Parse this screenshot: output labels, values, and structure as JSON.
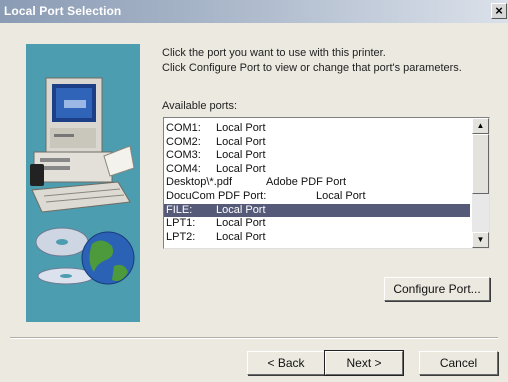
{
  "window": {
    "title": "Local Port Selection",
    "close_label": "×"
  },
  "instructions": {
    "line1": "Click the port you want to use with this printer.",
    "line2": "Click Configure Port to view or change that port's parameters."
  },
  "ports_label": "Available ports:",
  "ports": [
    {
      "port": "COM1:",
      "desc": "Local Port"
    },
    {
      "port": "COM2:",
      "desc": "Local Port"
    },
    {
      "port": "COM3:",
      "desc": "Local Port"
    },
    {
      "port": "COM4:",
      "desc": "Local Port"
    },
    {
      "port": "Desktop\\*.pdf",
      "desc": "Adobe PDF Port"
    },
    {
      "port": "DocuCom PDF Port:",
      "desc": "Local Port"
    },
    {
      "port": "FILE:",
      "desc": "Local Port"
    },
    {
      "port": "LPT1:",
      "desc": "Local Port"
    },
    {
      "port": "LPT2:",
      "desc": "Local Port"
    }
  ],
  "selected_port": "FILE:",
  "buttons": {
    "configure": "Configure Port...",
    "back": "< Back",
    "next": "Next >",
    "cancel": "Cancel"
  },
  "icons": {
    "art": [
      "computer-icon",
      "cd-disc-icon",
      "globe-icon"
    ],
    "scroll_up": "scroll-up-arrow-icon",
    "scroll_down": "scroll-down-arrow-icon"
  },
  "colors": {
    "art_panel": "#4d9db0",
    "selection": "#555a79",
    "dialog_bg": "#ece9e1"
  }
}
